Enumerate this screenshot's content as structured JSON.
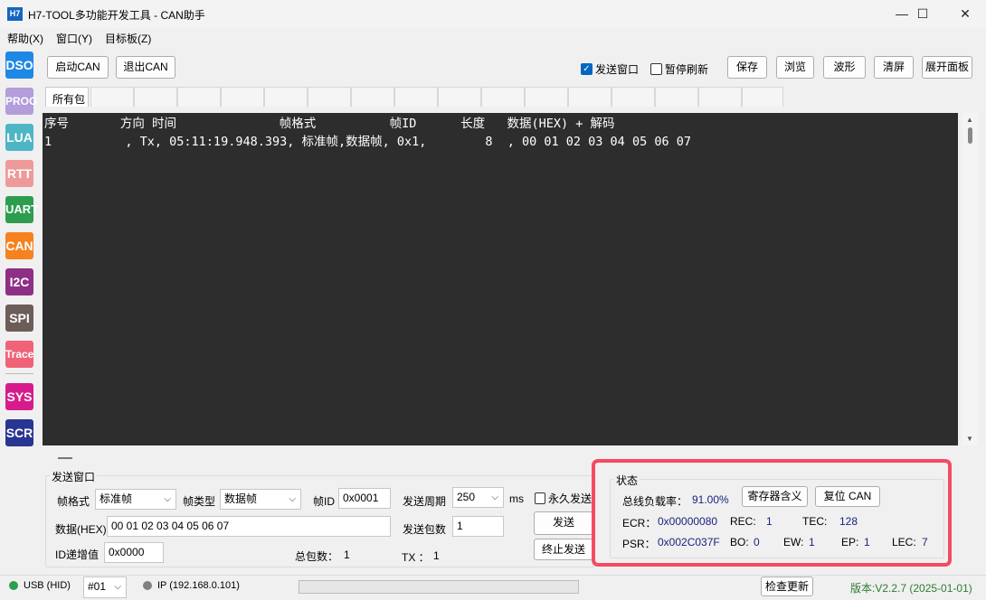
{
  "window": {
    "app_icon": "H7",
    "title": "H7-TOOL多功能开发工具 - CAN助手",
    "minimize_glyph": "—",
    "maximize_glyph": "☐",
    "close_glyph": "✕"
  },
  "menus": [
    "帮助(X)",
    "窗口(Y)",
    "目标板(Z)"
  ],
  "sidebar": [
    {
      "label": "DSO",
      "color": "#1e88e5"
    },
    {
      "label": "PROG",
      "color": "#b39ddb"
    },
    {
      "label": "LUA",
      "color": "#4db6c4"
    },
    {
      "label": "RTT",
      "color": "#ef9a9a"
    },
    {
      "label": "UART",
      "color": "#2e9d4e"
    },
    {
      "label": "CAN",
      "color": "#f5821f"
    },
    {
      "label": "I2C",
      "color": "#8e2f86"
    },
    {
      "label": "SPI",
      "color": "#6d5d58"
    },
    {
      "label": "Trace",
      "color": "#f06277"
    },
    {
      "label": "SYS",
      "color": "#d81b8c"
    },
    {
      "label": "SCR",
      "color": "#283593"
    }
  ],
  "toolbar": {
    "start_can": "启动CAN",
    "stop_can": "退出CAN",
    "send_window": "发送窗口",
    "send_window_checked": true,
    "pause_refresh": "暂停刷新",
    "pause_refresh_checked": false,
    "save": "保存",
    "browse": "浏览",
    "waveform": "波形",
    "clear": "清屏",
    "expand_panel": "展开面板"
  },
  "tabs": {
    "active": "所有包"
  },
  "terminal": {
    "header": "序号       方向 时间              帧格式          帧ID      长度   数据(HEX) + 解码",
    "rows": [
      "1          , Tx, 05:11:19.948.393, 标准帧,数据帧, 0x1,        8  , 00 01 02 03 04 05 06 07"
    ]
  },
  "send": {
    "group_title": "发送窗口",
    "frame_format_label": "帧格式",
    "frame_format_value": "标准帧",
    "frame_type_label": "帧类型",
    "frame_type_value": "数据帧",
    "frame_id_label": "帧ID",
    "frame_id_value": "0x0001",
    "period_label": "发送周期",
    "period_value": "250",
    "period_unit": "ms",
    "forever_label": "永久发送",
    "forever_checked": false,
    "data_label": "数据(HEX)",
    "data_value": "00 01 02 03 04 05 06 07",
    "count_label": "发送包数",
    "count_value": "1",
    "send_button": "发送",
    "id_inc_label": "ID递增值",
    "id_inc_value": "0x0000",
    "total_label": "总包数：",
    "total_value": "1",
    "tx_label": "TX ：",
    "tx_value": "1",
    "stop_button": "终止发送"
  },
  "status": {
    "group_title": "状态",
    "highlight_color": "#f44b62",
    "bus_load_label": "总线负载率：",
    "bus_load_value": "91.00%",
    "reg_meaning_button": "寄存器含义",
    "reset_can_button": "复位 CAN",
    "ecr_label": "ECR：",
    "ecr_value": "0x00000080",
    "rec_label": "REC:",
    "rec_value": "1",
    "tec_label": "TEC:",
    "tec_value": "128",
    "psr_label": "PSR：",
    "psr_value": "0x002C037F",
    "bo_label": "BO:",
    "bo_value": "0",
    "ew_label": "EW:",
    "ew_value": "1",
    "ep_label": "EP:",
    "ep_value": "1",
    "lec_label": "LEC:",
    "lec_value": "7"
  },
  "statusbar": {
    "usb": "USB (HID)",
    "usb_color": "#2e9d4e",
    "device": "#01",
    "ip": "IP (192.168.0.101)",
    "ip_color": "#808080",
    "check_update": "检查更新",
    "version": "版本:V2.2.7 (2025-01-01)",
    "version_color": "#2e7d32"
  }
}
